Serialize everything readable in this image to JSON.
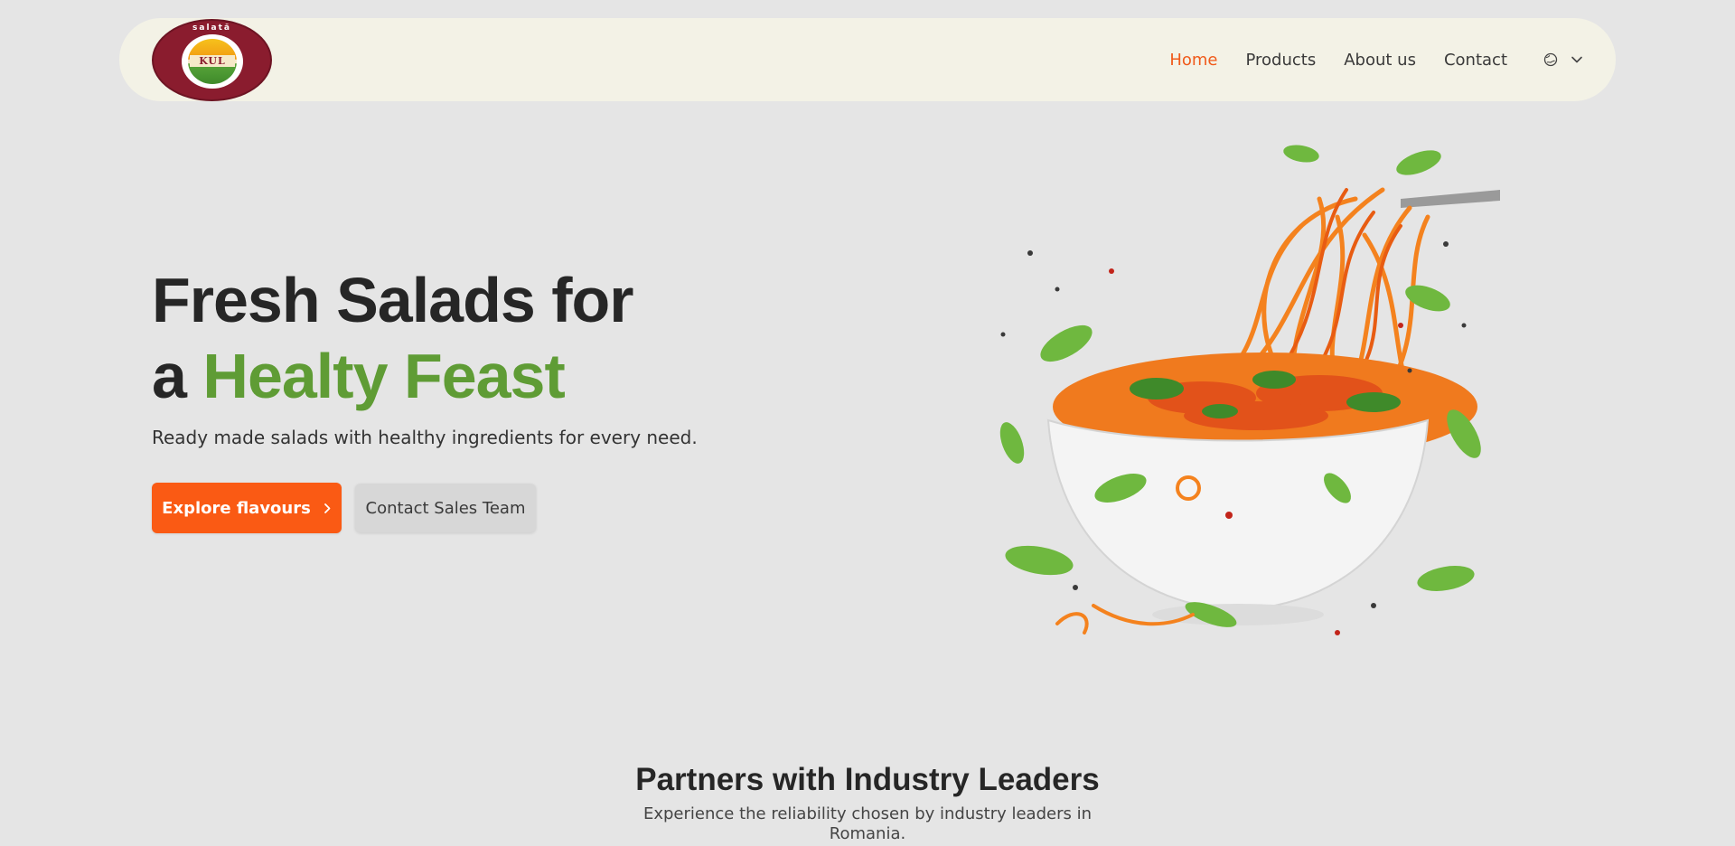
{
  "logo": {
    "top_word": "salată",
    "brand": "KUL"
  },
  "nav": {
    "items": [
      {
        "label": "Home",
        "active": true
      },
      {
        "label": "Products",
        "active": false
      },
      {
        "label": "About us",
        "active": false
      },
      {
        "label": "Contact",
        "active": false
      }
    ],
    "language_icon": "globe-icon",
    "language_dropdown_icon": "chevron-down-icon"
  },
  "hero": {
    "title_line1": "Fresh Salads for",
    "title_line2_prefix": "a ",
    "title_line2_accent": "Healty Feast",
    "subtitle": "Ready made salads with healthy ingredients for every need.",
    "primary_button": "Explore flavours",
    "secondary_button": "Contact Sales Team"
  },
  "partners": {
    "title": "Partners with Industry Leaders",
    "subtitle": "Experience the reliability chosen by industry leaders in Romania."
  },
  "colors": {
    "accent_orange": "#fa5a14",
    "accent_green": "#5f9c35",
    "nav_background": "#f3f2e6",
    "page_background": "#e5e5e5",
    "logo_maroon": "#8a1c2e"
  }
}
